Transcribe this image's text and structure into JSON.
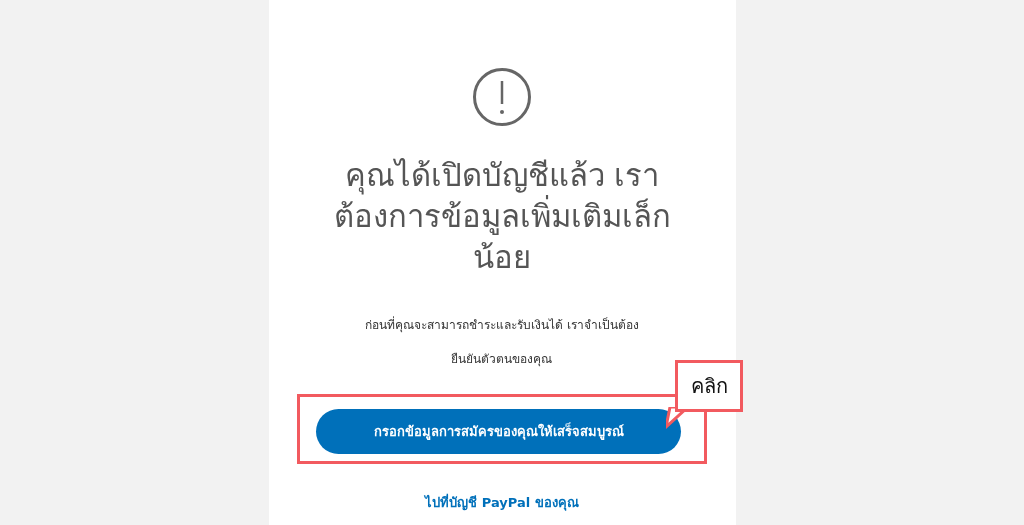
{
  "heading_lines": [
    "คุณได้เปิดบัญชีแล้ว เรา",
    "ต้องการข้อมูลเพิ่มเติมเล็ก",
    "น้อย"
  ],
  "message_lines": [
    "ก่อนที่คุณจะสามารถชำระและรับเงินได้ เราจำเป็นต้อง",
    "ยืนยันตัวตนของคุณ"
  ],
  "primary_button": "กรอกข้อมูลการสมัครของคุณให้เสร็จสมบูรณ์",
  "annotation": {
    "label": "คลิก"
  },
  "link": "ไปที่บัญชี PayPal ของคุณ"
}
